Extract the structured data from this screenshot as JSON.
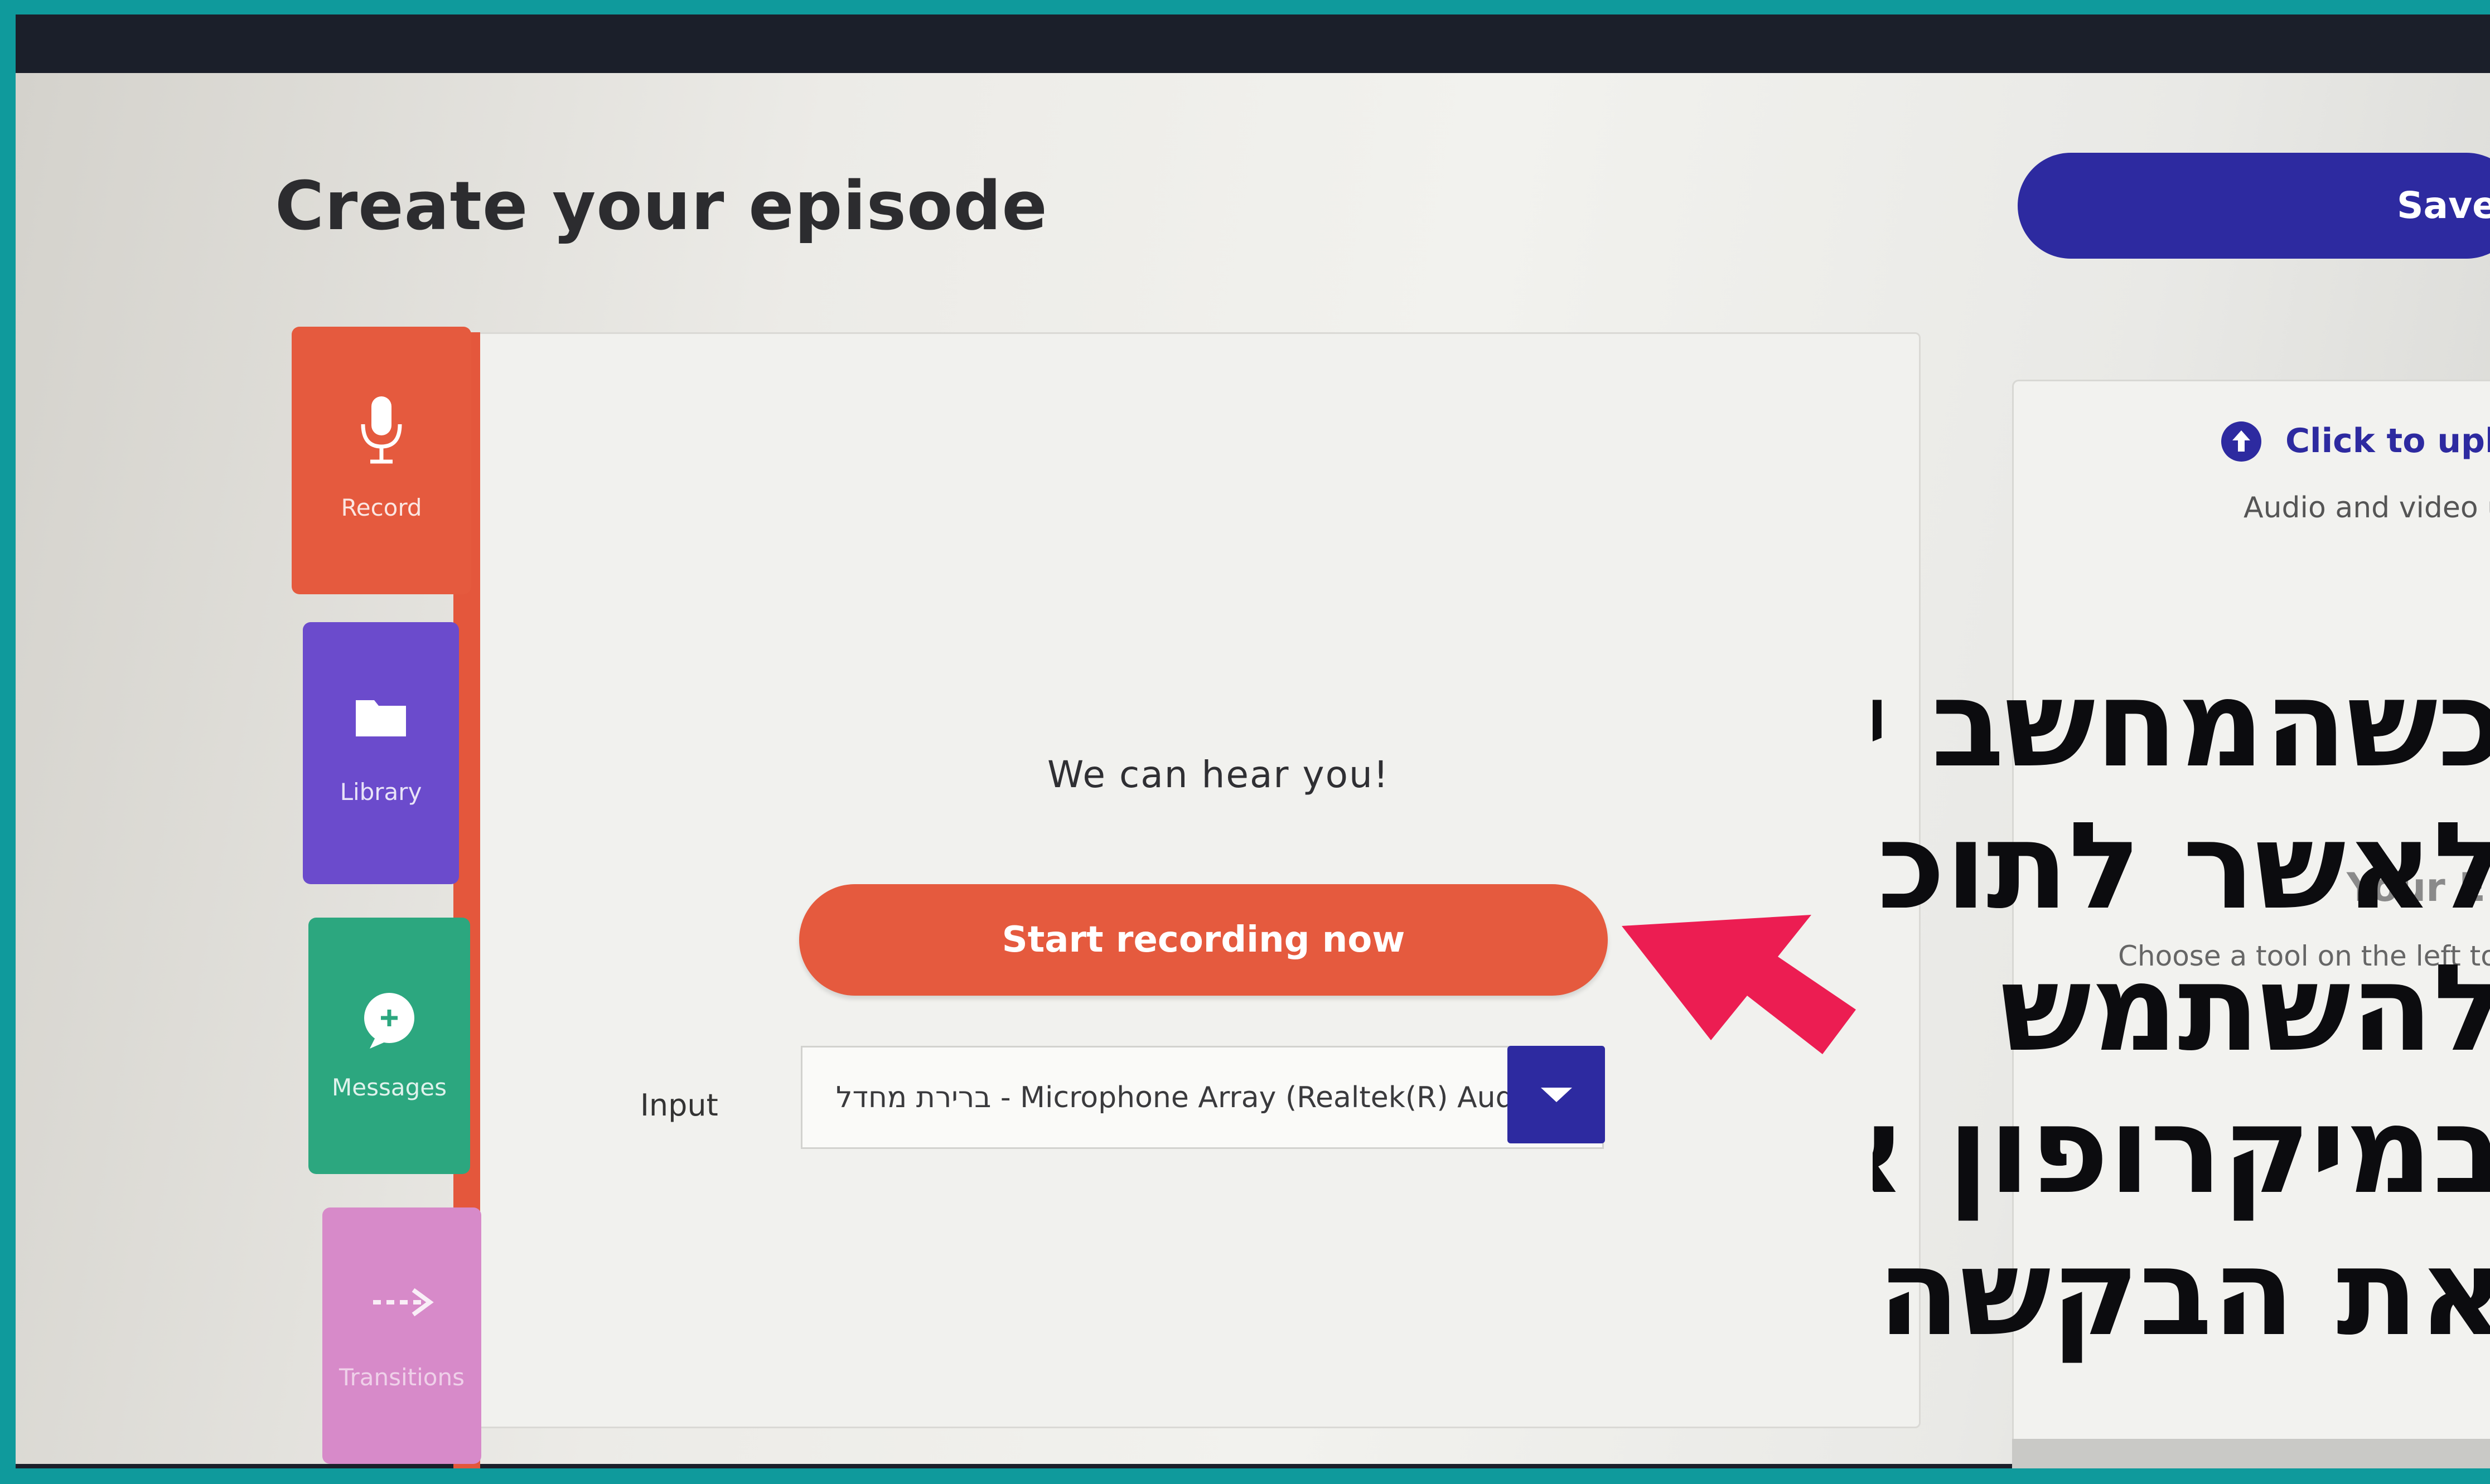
{
  "page": {
    "title": "Create your episode",
    "save_label": "Save"
  },
  "tools": [
    {
      "label": "Record",
      "icon": "microphone-icon",
      "color": "#e55a3e"
    },
    {
      "label": "Library",
      "icon": "folder-icon",
      "color": "#6b4bcc"
    },
    {
      "label": "Messages",
      "icon": "chat-plus-icon",
      "color": "#2ca77f"
    },
    {
      "label": "Transitions",
      "icon": "dashed-arrow-icon",
      "color": "#d78ac9"
    }
  ],
  "recorder": {
    "status_text": "We can hear you!",
    "start_label": "Start recording now",
    "input_label": "Input",
    "input_value": "ברירת מחדל - Microphone Array (Realtek(R) Audio)"
  },
  "right_panel": {
    "upload_text": "Click to upload",
    "upload_sub": "Audio and video up",
    "editor_title": "Your E",
    "editor_sub": "Choose a tool on the left to"
  },
  "overlay": {
    "lines": [
      "כשהמחשב יבקש",
      "לאשר לתוכנה",
      "להשתמש",
      "במיקרופון אשרו",
      "את הבקשה"
    ],
    "arrow_color": "#ec1d52"
  },
  "colors": {
    "frame": "#0f9a9c",
    "accent_orange": "#e55a3e",
    "accent_blue": "#2d2aa0"
  }
}
